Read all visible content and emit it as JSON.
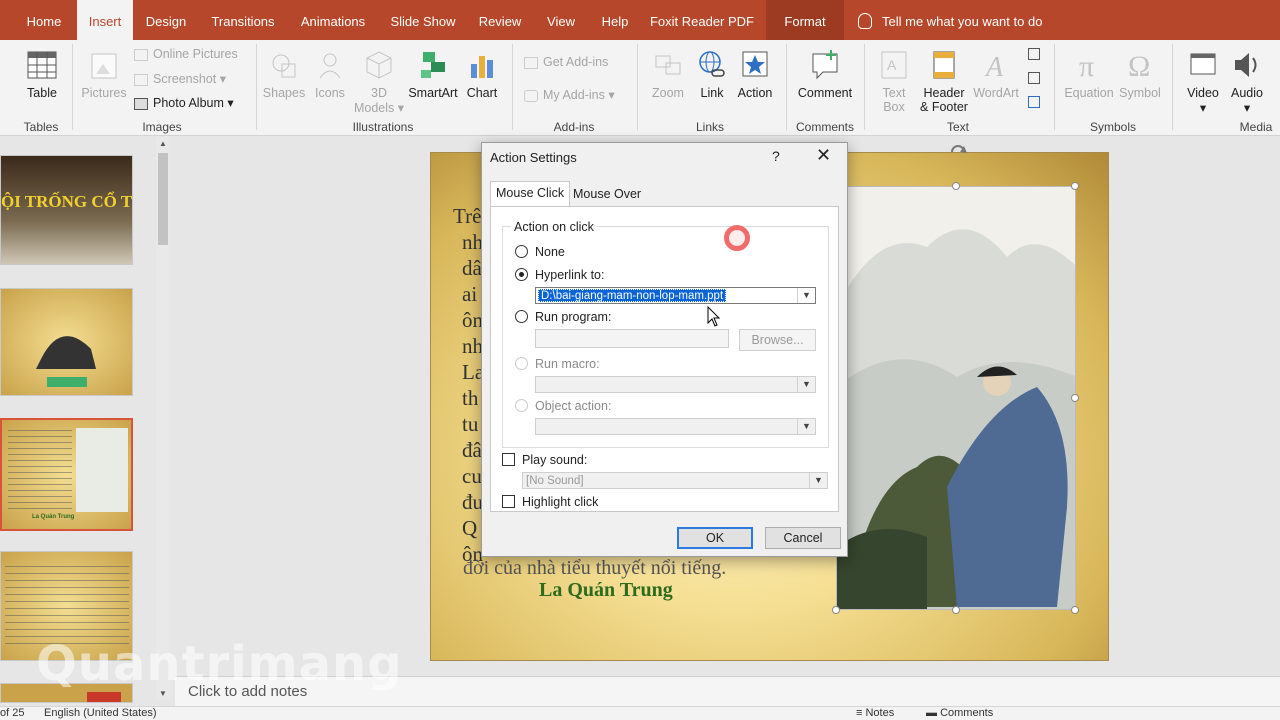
{
  "tabs": [
    {
      "label": "Home"
    },
    {
      "label": "Insert"
    },
    {
      "label": "Design"
    },
    {
      "label": "Transitions"
    },
    {
      "label": "Animations"
    },
    {
      "label": "Slide Show"
    },
    {
      "label": "Review"
    },
    {
      "label": "View"
    },
    {
      "label": "Help"
    },
    {
      "label": "Foxit Reader PDF"
    },
    {
      "label": "Format"
    }
  ],
  "tell_me": "Tell me what you want to do",
  "ribbon": {
    "table": "Table",
    "pictures": "Pictures",
    "online_pictures": "Online Pictures",
    "screenshot": "Screenshot",
    "photo_album": "Photo Album",
    "shapes": "Shapes",
    "icons": "Icons",
    "models_3d": "3D",
    "models_3d_2": "Models",
    "smartart": "SmartArt",
    "chart": "Chart",
    "get_addins": "Get Add-ins",
    "my_addins": "My Add-ins",
    "zoom": "Zoom",
    "link": "Link",
    "action": "Action",
    "comment": "Comment",
    "text_box": "Text",
    "text_box_2": "Box",
    "header_footer": "Header",
    "header_footer_2": "& Footer",
    "wordart": "WordArt",
    "equation": "Equation",
    "symbol": "Symbol",
    "video": "Video",
    "audio": "Audio",
    "groups": {
      "tables": "Tables",
      "images": "Images",
      "illustrations": "Illustrations",
      "addins": "Add-ins",
      "links": "Links",
      "comments": "Comments",
      "text": "Text",
      "symbols": "Symbols",
      "media": "Media"
    }
  },
  "thumbs": {
    "t1_title": "ỘI TRỐNG CỔ THÀNH",
    "t3_author": "La Quán Trung"
  },
  "slide": {
    "lines": [
      "Trê",
      "nh",
      "dâ",
      "ai",
      "ôn",
      "nh",
      "La",
      "th",
      "tu",
      "đâ",
      "cu",
      "đu",
      "Q",
      "ôn"
    ],
    "caption": "đời của nhà tiểu thuyết nổi tiếng.",
    "author": "La Quán Trung"
  },
  "notes_placeholder": "Click to add notes",
  "status": {
    "slide_of": "of 25",
    "language": "English (United States)",
    "notes": "Notes",
    "comments": "Comments"
  },
  "watermark": "Quantrimang",
  "dialog": {
    "title": "Action Settings",
    "help": "?",
    "close": "✕",
    "tab_mouse_click": "Mouse Click",
    "tab_mouse_over": "Mouse Over",
    "group_title": "Action on click",
    "none": "None",
    "hyperlink_to": "Hyperlink to:",
    "hyperlink_value": "D:\\bai-giang-mam-non-lop-mam.ppt",
    "run_program": "Run program:",
    "browse": "Browse...",
    "run_macro": "Run macro:",
    "object_action": "Object action:",
    "play_sound": "Play sound:",
    "sound_value": "[No Sound]",
    "highlight_click": "Highlight click",
    "ok": "OK",
    "cancel": "Cancel"
  },
  "colors": {
    "accent": "#b7472a",
    "selection": "#0a64d6"
  }
}
